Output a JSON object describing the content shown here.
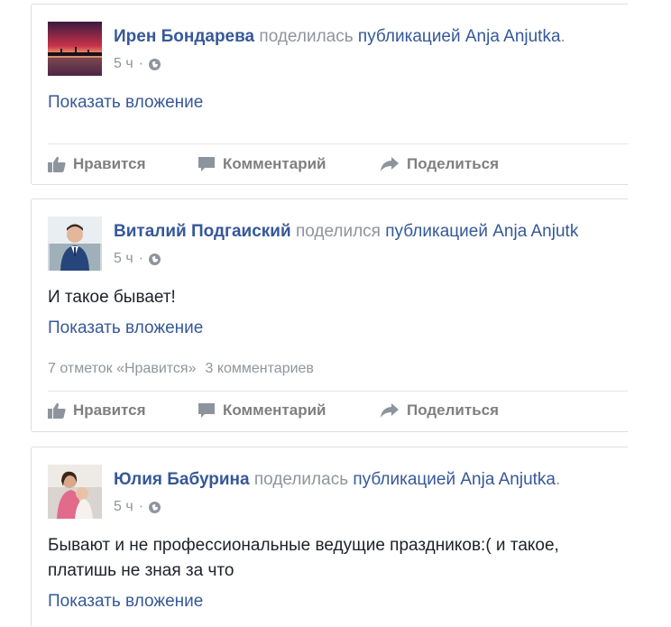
{
  "colors": {
    "link": "#365899",
    "muted": "#90949c",
    "text": "#1d2129",
    "action": "#7f7f7f"
  },
  "posts": [
    {
      "author": "Ирен Бондарева",
      "verb": "поделилась",
      "object": "публикацией Anja Anjutka",
      "period": ".",
      "time": "5 ч",
      "separator": "·",
      "text": "",
      "attachment_label": "Показать вложение",
      "likes": "",
      "comments": ""
    },
    {
      "author": "Виталий Подгаиский",
      "verb": "поделился",
      "object": "публикацией Anja Anjutk",
      "period": "",
      "time": "5 ч",
      "separator": "·",
      "text": "И такое бывает!",
      "attachment_label": "Показать вложение",
      "likes": "7 отметок «Нравится»",
      "comments": "3 комментариев"
    },
    {
      "author": "Юлия Бабурина",
      "verb": "поделилась",
      "object": "публикацией Anja Anjutka",
      "period": ".",
      "time": "5 ч",
      "separator": "·",
      "text": "Бывают и не профессиональные ведущие праздников:( и такое, платишь не зная за что",
      "attachment_label": "Показать вложение",
      "likes": "",
      "comments": ""
    }
  ],
  "actions": {
    "like": "Нравится",
    "comment": "Комментарий",
    "share": "Поделиться"
  },
  "icons": {
    "like": "thumbs-up-icon",
    "comment": "comment-bubble-icon",
    "share": "share-arrow-icon",
    "privacy": "globe-icon"
  }
}
